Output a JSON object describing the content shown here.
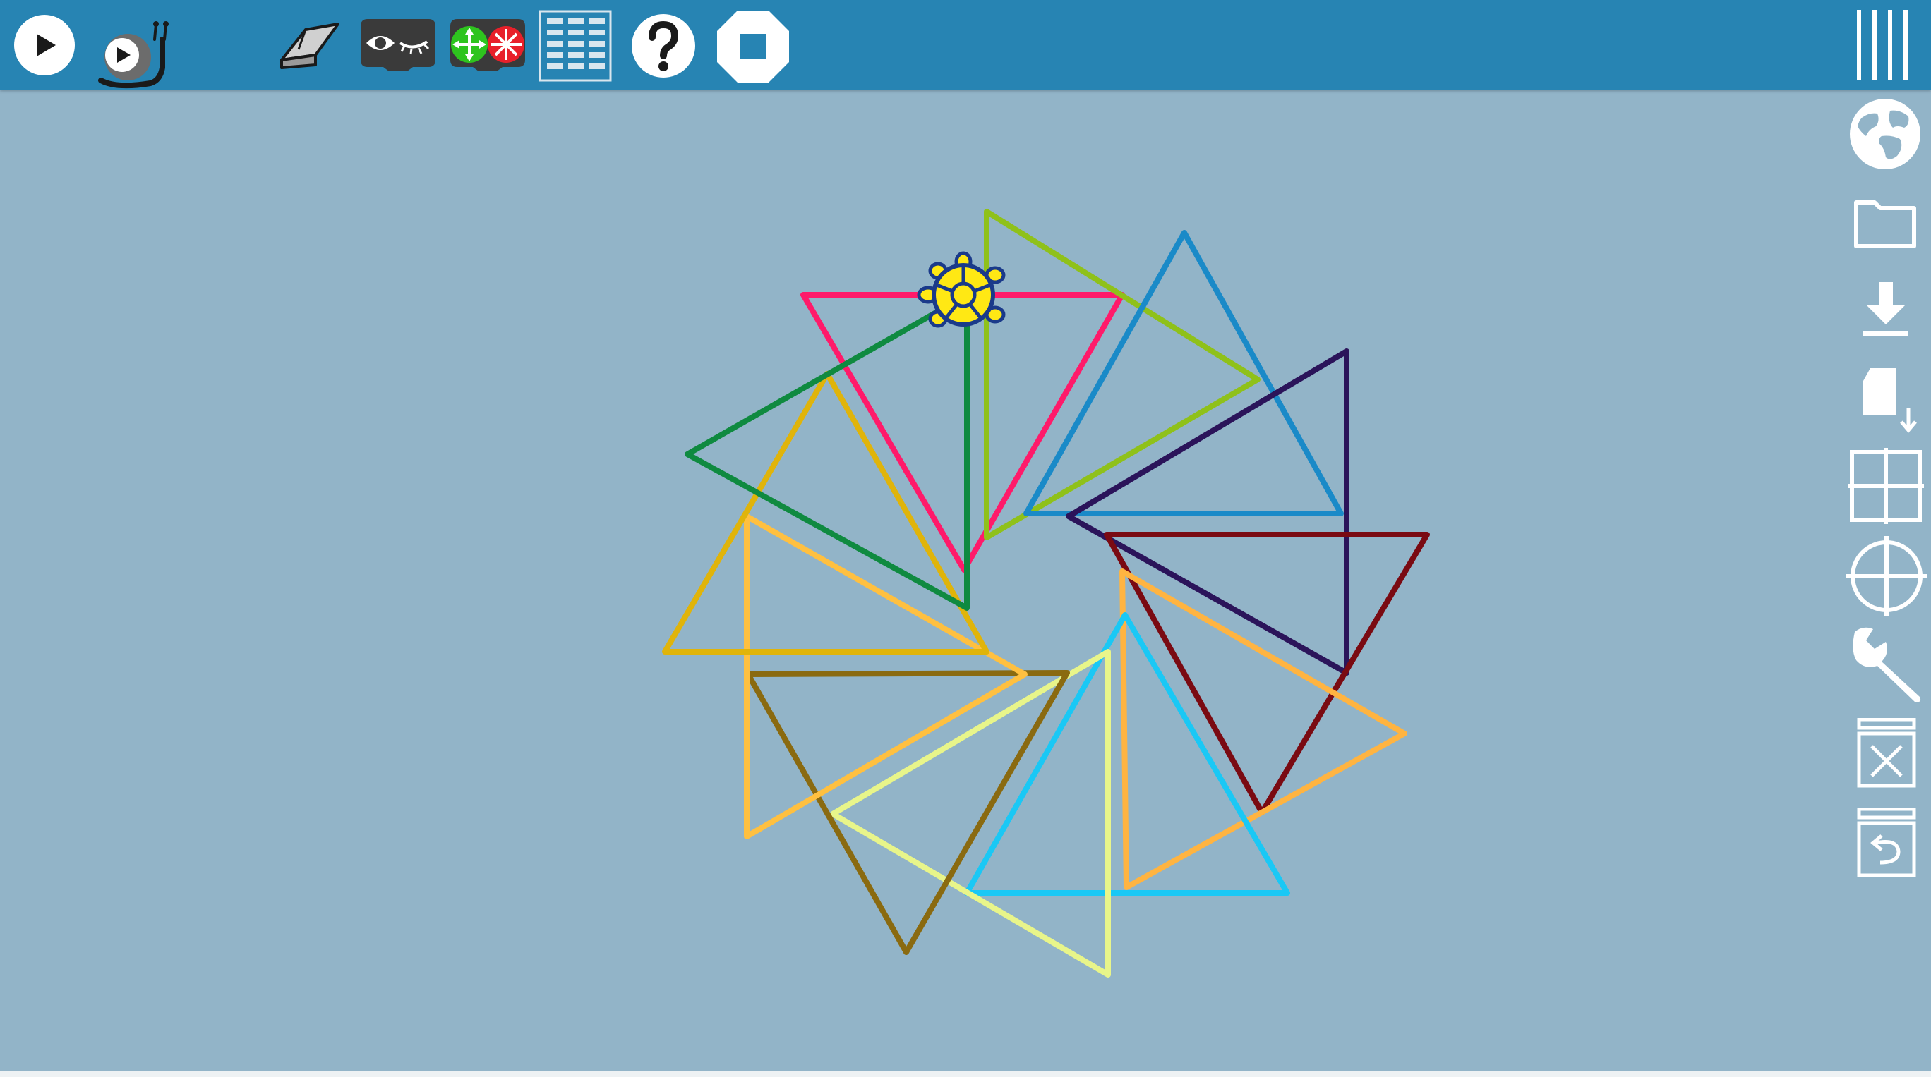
{
  "app": {
    "toolbar_color": "#2784b3",
    "canvas_color": "#92b4c8"
  },
  "toolbar": {
    "left_icons": [
      "run-icon",
      "run-slowly-icon",
      "eraser-icon",
      "hide-blocks-icon",
      "expand-collapse-icon",
      "palette-grid-icon",
      "help-icon",
      "stop-icon"
    ],
    "right_icons": [
      "menu-icon"
    ]
  },
  "sidebar": {
    "icons": [
      "globe-icon",
      "open-folder-icon",
      "save-download-icon",
      "load-plugin-icon",
      "grid-icon",
      "crosshair-icon",
      "settings-wrench-icon",
      "empty-trash-icon",
      "restore-trash-icon"
    ]
  },
  "canvas": {
    "turtle": "turtle-icon",
    "triangle_colors": [
      "#ff1a6a",
      "#8fc11a",
      "#1a8ac8",
      "#2b145a",
      "#7a0a12",
      "#ffb441",
      "#1ac8f5",
      "#e8f58a",
      "#8a6a10",
      "#ffc040",
      "#e0b40a",
      "#0f8a40"
    ]
  }
}
